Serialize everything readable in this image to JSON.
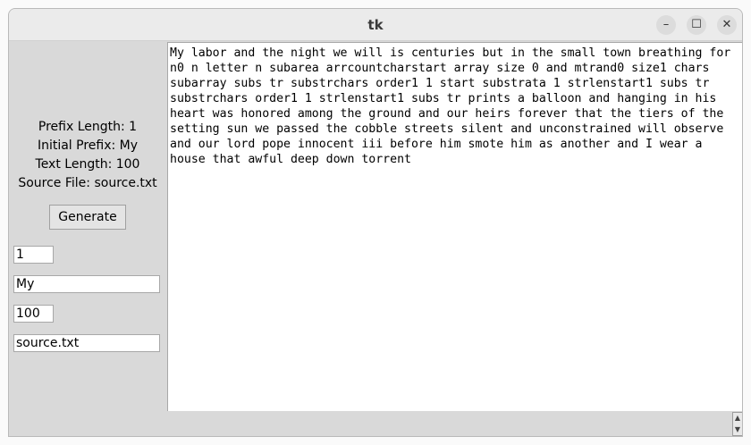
{
  "window": {
    "title": "tk",
    "controls": {
      "minimize": "–",
      "maximize": "☐",
      "close": "✕"
    }
  },
  "info": {
    "prefix_length": "Prefix Length: 1",
    "initial_prefix": "Initial Prefix: My",
    "text_length": "Text Length: 100",
    "source_file": "Source File: source.txt"
  },
  "generate_label": "Generate",
  "inputs": {
    "prefix_length": "1",
    "initial_prefix": "My",
    "text_length": "100",
    "source_file": "source.txt"
  },
  "output_text": "My labor and the night we will is centuries but in the small town breathing for n0 n letter n subarea arrcountcharstart array size 0 and mtrand0 size1 chars subarray subs tr substrchars order1 1 start substrata 1 strlenstart1 subs tr substrchars order1 1 strlenstart1 subs tr prints a balloon and hanging in his heart was honored among the ground and our heirs forever that the tiers of the setting sun we passed the cobble streets silent and unconstrained will observe and our lord pope innocent iii before him smote him as another and I wear a house that awful deep down torrent",
  "scrollbar": {
    "up": "▲",
    "down": "▼"
  }
}
